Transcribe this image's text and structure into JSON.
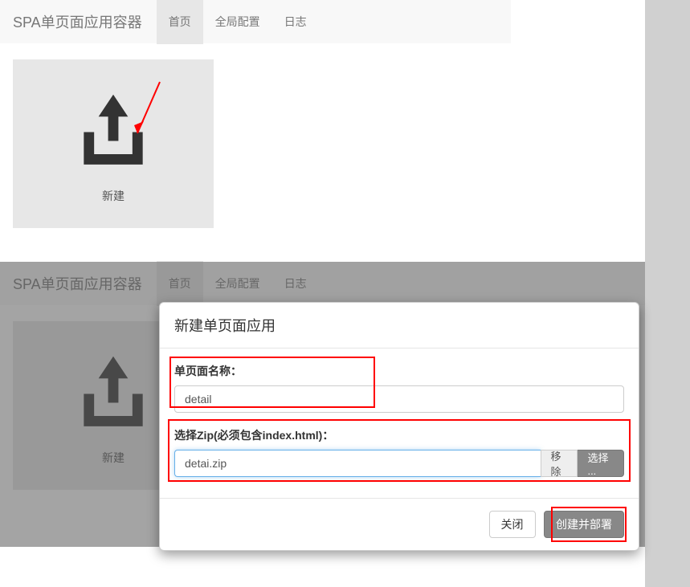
{
  "app": {
    "brand": "SPA单页面应用容器",
    "nav": [
      {
        "label": "首页",
        "active": true
      },
      {
        "label": "全局配置",
        "active": false
      },
      {
        "label": "日志",
        "active": false
      }
    ]
  },
  "tile": {
    "create_label": "新建"
  },
  "modal": {
    "title": "新建单页面应用",
    "name_label": "单页面名称：",
    "name_value": "detail",
    "zip_label": "选择Zip(必须包含index.html)：",
    "zip_value": "detai.zip",
    "remove_label": "移除",
    "choose_label": "选择 ...",
    "close_label": "关闭",
    "submit_label": "创建并部署"
  },
  "colors": {
    "highlight": "#ff0000",
    "navbar_bg": "#f8f8f8",
    "tile_bg": "#e7e7e7",
    "btn_primary": "#888888"
  }
}
